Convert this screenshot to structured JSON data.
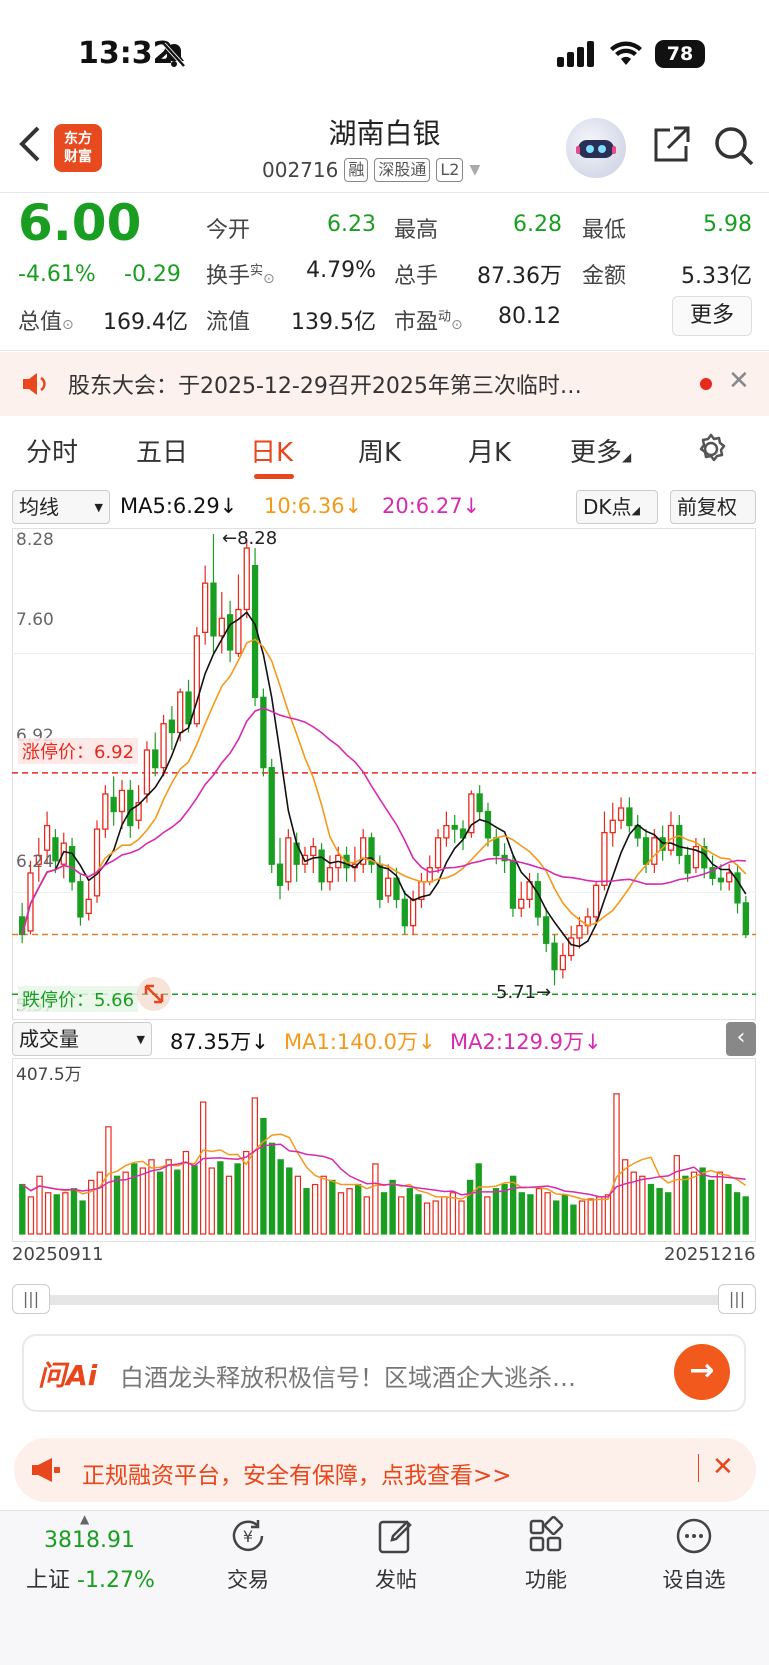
{
  "status": {
    "time": "13:32",
    "battery": "78"
  },
  "header": {
    "title": "湖南白银",
    "code": "002716",
    "tags": [
      "融",
      "深股通",
      "L2"
    ],
    "logo_line1": "东方",
    "logo_line2": "财富"
  },
  "quote": {
    "price": "6.00",
    "change_pct": "-4.61%",
    "change": "-0.29",
    "open_label": "今开",
    "open": "6.23",
    "high_label": "最高",
    "high": "6.28",
    "low_label": "最低",
    "low": "5.98",
    "turnover_label": "换手",
    "turnover_sup": "实",
    "turnover": "4.79%",
    "volume_label": "总手",
    "volume": "87.36万",
    "amount_label": "金额",
    "amount": "5.33亿",
    "mktcap_label": "总值",
    "mktcap": "169.4亿",
    "float_label": "流值",
    "float": "139.5亿",
    "pe_label": "市盈",
    "pe_sup": "动",
    "pe": "80.12",
    "more_label": "更多"
  },
  "notice": {
    "text": "股东大会：于2025-12-29召开2025年第三次临时…"
  },
  "tabs": [
    "分时",
    "五日",
    "日K",
    "周K",
    "月K",
    "更多"
  ],
  "indicators": {
    "ma_select": "均线",
    "ma5": "MA5:6.29↓",
    "ma10": "10:6.36↓",
    "ma20": "20:6.27↓",
    "dk": "DK点",
    "adjust": "前复权",
    "vol_select": "成交量",
    "vol": "87.35万↓",
    "vma1": "MA1:140.0万↓",
    "vma2": "MA2:129.9万↓"
  },
  "chart_labels": {
    "y_top": "8.28",
    "y_2": "7.60",
    "y_3": "6.92",
    "y_4": "6.24",
    "y_bottom": "5.57",
    "max_mark": "←8.28",
    "min_mark": "5.71→",
    "limit_up": "涨停价：6.92",
    "limit_down": "跌停价：5.66",
    "vol_max": "407.5万",
    "date_start": "20250911",
    "date_end": "20251216"
  },
  "colors": {
    "up": "#e8291c",
    "down": "#1a9e22",
    "ma5": "#111111",
    "ma10": "#f39a1c",
    "ma20": "#d62bb0",
    "accent": "#e8461c"
  },
  "chart_data": {
    "type": "candlestick",
    "x_range": [
      "20250911",
      "20251216"
    ],
    "ylim": [
      5.57,
      8.28
    ],
    "limit_up": 6.92,
    "limit_down": 5.66,
    "candles": [
      [
        6.1,
        6.0,
        6.18,
        5.95
      ],
      [
        6.02,
        6.35,
        6.42,
        6.0
      ],
      [
        6.4,
        6.45,
        6.55,
        6.3
      ],
      [
        6.48,
        6.62,
        6.7,
        6.4
      ],
      [
        6.55,
        6.42,
        6.6,
        6.35
      ],
      [
        6.4,
        6.52,
        6.58,
        6.32
      ],
      [
        6.5,
        6.3,
        6.55,
        6.25
      ],
      [
        6.3,
        6.1,
        6.35,
        6.05
      ],
      [
        6.12,
        6.2,
        6.3,
        6.08
      ],
      [
        6.22,
        6.6,
        6.65,
        6.18
      ],
      [
        6.6,
        6.8,
        6.85,
        6.55
      ],
      [
        6.78,
        6.7,
        6.9,
        6.62
      ],
      [
        6.7,
        6.82,
        6.88,
        6.6
      ],
      [
        6.82,
        6.62,
        6.88,
        6.55
      ],
      [
        6.65,
        6.75,
        6.85,
        6.6
      ],
      [
        6.8,
        7.05,
        7.1,
        6.75
      ],
      [
        7.05,
        6.95,
        7.15,
        6.9
      ],
      [
        6.95,
        7.2,
        7.25,
        6.9
      ],
      [
        7.22,
        7.15,
        7.3,
        7.05
      ],
      [
        7.15,
        7.38,
        7.4,
        7.1
      ],
      [
        7.38,
        7.2,
        7.45,
        7.15
      ],
      [
        7.2,
        7.7,
        7.75,
        7.18
      ],
      [
        7.72,
        8.0,
        8.1,
        7.65
      ],
      [
        8.0,
        7.7,
        8.28,
        7.6
      ],
      [
        7.7,
        7.8,
        7.95,
        7.6
      ],
      [
        7.82,
        7.62,
        7.9,
        7.55
      ],
      [
        7.6,
        7.85,
        8.05,
        7.58
      ],
      [
        7.85,
        8.2,
        8.25,
        7.8
      ],
      [
        8.1,
        7.35,
        8.2,
        7.3
      ],
      [
        7.35,
        6.95,
        7.4,
        6.9
      ],
      [
        6.95,
        6.4,
        7.0,
        6.35
      ],
      [
        6.4,
        6.28,
        6.55,
        6.2
      ],
      [
        6.3,
        6.55,
        6.6,
        6.25
      ],
      [
        6.52,
        6.4,
        6.58,
        6.3
      ],
      [
        6.4,
        6.45,
        6.5,
        6.35
      ],
      [
        6.45,
        6.5,
        6.55,
        6.35
      ],
      [
        6.48,
        6.3,
        6.52,
        6.25
      ],
      [
        6.3,
        6.38,
        6.45,
        6.25
      ],
      [
        6.38,
        6.45,
        6.5,
        6.3
      ],
      [
        6.45,
        6.38,
        6.5,
        6.3
      ],
      [
        6.38,
        6.4,
        6.5,
        6.3
      ],
      [
        6.4,
        6.55,
        6.6,
        6.35
      ],
      [
        6.55,
        6.4,
        6.58,
        6.35
      ],
      [
        6.4,
        6.2,
        6.45,
        6.15
      ],
      [
        6.22,
        6.32,
        6.4,
        6.18
      ],
      [
        6.32,
        6.2,
        6.38,
        6.15
      ],
      [
        6.2,
        6.05,
        6.25,
        6.0
      ],
      [
        6.05,
        6.2,
        6.25,
        6.0
      ],
      [
        6.2,
        6.3,
        6.35,
        6.15
      ],
      [
        6.3,
        6.38,
        6.45,
        6.28
      ],
      [
        6.38,
        6.55,
        6.6,
        6.35
      ],
      [
        6.55,
        6.62,
        6.7,
        6.5
      ],
      [
        6.62,
        6.6,
        6.68,
        6.52
      ],
      [
        6.6,
        6.55,
        6.65,
        6.48
      ],
      [
        6.58,
        6.8,
        6.82,
        6.55
      ],
      [
        6.8,
        6.7,
        6.85,
        6.65
      ],
      [
        6.7,
        6.55,
        6.75,
        6.5
      ],
      [
        6.55,
        6.45,
        6.6,
        6.4
      ],
      [
        6.45,
        6.42,
        6.52,
        6.35
      ],
      [
        6.42,
        6.15,
        6.45,
        6.1
      ],
      [
        6.15,
        6.2,
        6.3,
        6.1
      ],
      [
        6.2,
        6.3,
        6.35,
        6.15
      ],
      [
        6.3,
        6.1,
        6.35,
        6.05
      ],
      [
        6.1,
        5.95,
        6.15,
        5.9
      ],
      [
        5.95,
        5.8,
        6.0,
        5.71
      ],
      [
        5.8,
        5.88,
        5.95,
        5.75
      ],
      [
        5.88,
        5.98,
        6.05,
        5.85
      ],
      [
        5.98,
        6.05,
        6.1,
        5.92
      ],
      [
        6.05,
        6.1,
        6.15,
        6.0
      ],
      [
        6.1,
        6.28,
        6.3,
        6.05
      ],
      [
        6.28,
        6.58,
        6.7,
        6.25
      ],
      [
        6.58,
        6.65,
        6.75,
        6.5
      ],
      [
        6.65,
        6.72,
        6.78,
        6.6
      ],
      [
        6.72,
        6.62,
        6.78,
        6.58
      ],
      [
        6.62,
        6.55,
        6.68,
        6.5
      ],
      [
        6.55,
        6.4,
        6.6,
        6.35
      ],
      [
        6.4,
        6.55,
        6.6,
        6.35
      ],
      [
        6.55,
        6.48,
        6.62,
        6.42
      ],
      [
        6.48,
        6.62,
        6.7,
        6.45
      ],
      [
        6.62,
        6.45,
        6.68,
        6.4
      ],
      [
        6.45,
        6.35,
        6.5,
        6.3
      ],
      [
        6.38,
        6.5,
        6.55,
        6.35
      ],
      [
        6.5,
        6.38,
        6.55,
        6.32
      ],
      [
        6.38,
        6.32,
        6.45,
        6.28
      ],
      [
        6.32,
        6.3,
        6.4,
        6.25
      ],
      [
        6.3,
        6.35,
        6.4,
        6.25
      ],
      [
        6.35,
        6.18,
        6.4,
        6.12
      ],
      [
        6.18,
        6.0,
        6.22,
        5.98
      ]
    ],
    "volumes": [
      120,
      90,
      140,
      100,
      95,
      100,
      110,
      80,
      130,
      150,
      260,
      140,
      150,
      170,
      160,
      180,
      150,
      180,
      155,
      200,
      165,
      320,
      160,
      175,
      140,
      170,
      200,
      330,
      280,
      220,
      180,
      160,
      140,
      110,
      120,
      140,
      130,
      100,
      110,
      120,
      90,
      170,
      100,
      130,
      90,
      110,
      95,
      75,
      80,
      90,
      100,
      80,
      130,
      170,
      90,
      110,
      120,
      140,
      100,
      95,
      110,
      100,
      80,
      95,
      70,
      80,
      85,
      90,
      95,
      340,
      180,
      150,
      140,
      120,
      110,
      100,
      190,
      140,
      150,
      160,
      130,
      150,
      120,
      100,
      90
    ],
    "vol_max": 407.5
  }
}
